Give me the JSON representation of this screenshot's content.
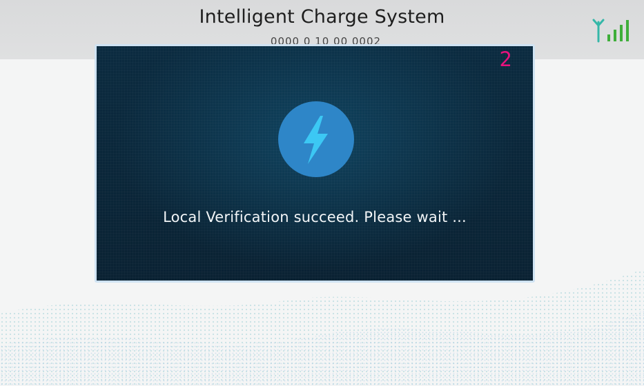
{
  "header": {
    "title": "Intelligent Charge System",
    "sub_line": "0000 0 10 00 0002",
    "signal_icon": "signal-strength-icon"
  },
  "dialog": {
    "countdown": "2",
    "icon": "lightning-bolt-icon",
    "message": "Local Verification succeed. Please wait ...",
    "colors": {
      "countdown": "#e8127e",
      "icon_circle": "#2e86c8",
      "bolt": "#3cc8f4"
    }
  }
}
